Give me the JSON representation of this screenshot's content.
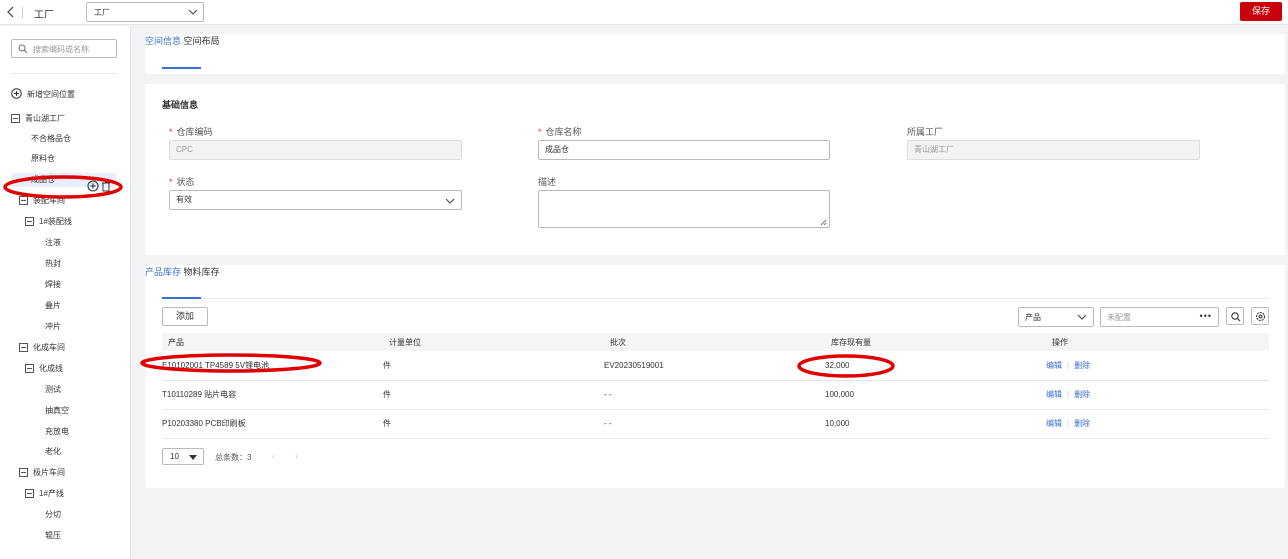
{
  "topbar": {
    "title": "工厂",
    "factory_select": "工厂",
    "save_label": "保存"
  },
  "sidebar": {
    "search_placeholder": "搜索编码或名称",
    "new_position": "新增空间位置",
    "tree": [
      {
        "label": "青山湖工厂"
      },
      {
        "label": "不合格品仓"
      },
      {
        "label": "原料仓"
      },
      {
        "label": "成品仓"
      },
      {
        "label": "装配车间"
      },
      {
        "label": "1#装配线"
      },
      {
        "label": "注液"
      },
      {
        "label": "热封"
      },
      {
        "label": "焊接"
      },
      {
        "label": "叠片"
      },
      {
        "label": "冲片"
      },
      {
        "label": "化成车间"
      },
      {
        "label": "化成线"
      },
      {
        "label": "测试"
      },
      {
        "label": "抽真空"
      },
      {
        "label": "充放电"
      },
      {
        "label": "老化"
      },
      {
        "label": "极片车间"
      },
      {
        "label": "1#产线"
      },
      {
        "label": "分切"
      },
      {
        "label": "辊压"
      }
    ]
  },
  "top_tabs": [
    "空间信息",
    "空间布局"
  ],
  "basic": {
    "title": "基础信息",
    "code_label": "仓库编码",
    "code_value": "CPC",
    "name_label": "仓库名称",
    "name_value": "成品仓",
    "factory_label": "所属工厂",
    "factory_value": "青山湖工厂",
    "status_label": "状态",
    "status_value": "有效",
    "desc_label": "描述"
  },
  "inventory": {
    "tabs": [
      "产品库存",
      "物料库存"
    ],
    "add_label": "添加",
    "filter_select": "产品",
    "filter_placeholder": "未配置",
    "columns": [
      "产品",
      "计量单位",
      "批次",
      "库存现有量",
      "操作"
    ],
    "rows": [
      {
        "product": "E10102001 TP4589 5V锂电池",
        "unit": "件",
        "batch": "EV20230519001",
        "qty": "32,000",
        "edit": "编辑",
        "del": "删除"
      },
      {
        "product": "T10110289 贴片电容",
        "unit": "件",
        "batch": "- -",
        "qty": "100,000",
        "edit": "编辑",
        "del": "删除"
      },
      {
        "product": "P10203380 PCB印刷板",
        "unit": "件",
        "batch": "- -",
        "qty": "10,000",
        "edit": "编辑",
        "del": "删除"
      }
    ],
    "page_size": "10",
    "total_label": "总条数：3",
    "prev": "‹",
    "next": "›"
  },
  "colors": {
    "accent": "#3b6fd4",
    "brand": "#c7000b",
    "annotation": "#e00000"
  }
}
